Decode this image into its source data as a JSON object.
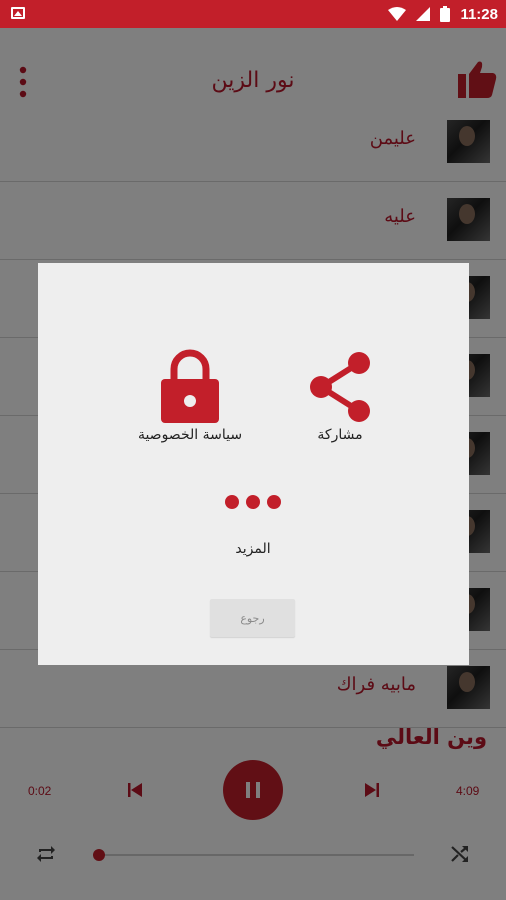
{
  "status_bar": {
    "time": "11:28",
    "battery_level": "12"
  },
  "toolbar": {
    "title": "نور الزين",
    "like_icon": "thumbs-up-icon",
    "more_icon": "more-vert-icon"
  },
  "songs": [
    {
      "name": "عليمن"
    },
    {
      "name": "عليه"
    },
    {
      "name": ""
    },
    {
      "name": ""
    },
    {
      "name": ""
    },
    {
      "name": ""
    },
    {
      "name": ""
    },
    {
      "name": "مابيه فراك"
    }
  ],
  "now_playing": {
    "title": "وين العالي"
  },
  "player": {
    "elapsed": "0:02",
    "duration": "4:09",
    "progress_fraction": 0.01
  },
  "dialog": {
    "share_label": "مشاركة",
    "privacy_label": "سياسة الخصوصية",
    "more_label": "المزيد",
    "back_label": "رجوع"
  },
  "colors": {
    "accent": "#c21f2a",
    "text_accent": "#b8162a",
    "dialog_bg": "#eeeeee"
  }
}
